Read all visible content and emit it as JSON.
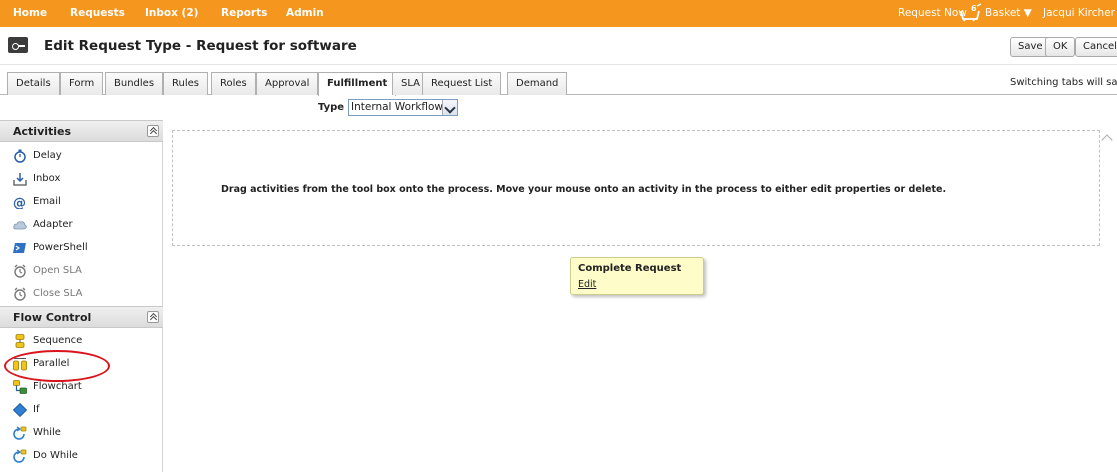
{
  "topnav": {
    "home": "Home",
    "requests": "Requests",
    "inbox": "Inbox (2)",
    "reports": "Reports",
    "admin": "Admin",
    "request_now": "Request Now",
    "basket_count": "6",
    "basket": "Basket ▼",
    "user": "Jacqui Kircher ▼"
  },
  "header": {
    "title": "Edit Request Type - Request for software",
    "save": "Save",
    "ok": "OK",
    "cancel": "Cancel"
  },
  "tabs": [
    {
      "label": "Details"
    },
    {
      "label": "Form"
    },
    {
      "label": "Bundles"
    },
    {
      "label": "Rules"
    },
    {
      "label": "Roles"
    },
    {
      "label": "Approval"
    },
    {
      "label": "Fulfillment",
      "active": true
    },
    {
      "label": "SLA"
    },
    {
      "label": "Request List"
    },
    {
      "label": "Demand"
    }
  ],
  "switch_note": "Switching tabs will save",
  "type": {
    "label": "Type",
    "value": "Internal Workflow"
  },
  "sidebar": {
    "activities": {
      "title": "Activities",
      "items": [
        {
          "label": "Delay",
          "icon": "stopwatch-icon"
        },
        {
          "label": "Inbox",
          "icon": "inbox-tray-icon"
        },
        {
          "label": "Email",
          "icon": "at-sign-icon"
        },
        {
          "label": "Adapter",
          "icon": "cloud-icon"
        },
        {
          "label": "PowerShell",
          "icon": "powershell-icon"
        },
        {
          "label": "Open SLA",
          "icon": "clock-icon"
        },
        {
          "label": "Close SLA",
          "icon": "clock-icon"
        }
      ]
    },
    "flow_control": {
      "title": "Flow Control",
      "items": [
        {
          "label": "Sequence",
          "icon": "sequence-icon"
        },
        {
          "label": "Parallel",
          "icon": "parallel-icon"
        },
        {
          "label": "Flowchart",
          "icon": "flowchart-icon"
        },
        {
          "label": "If",
          "icon": "diamond-icon"
        },
        {
          "label": "While",
          "icon": "loop-icon"
        },
        {
          "label": "Do While",
          "icon": "loop-icon"
        }
      ]
    }
  },
  "canvas": {
    "message": "Drag activities from the tool box onto the process. Move your mouse onto an activity in the process to either edit properties or delete.",
    "complete_title": "Complete Request",
    "complete_edit": "Edit"
  },
  "colors": {
    "nav_orange": "#f5961e",
    "highlight_red": "#d9141c",
    "note_yellow": "#fefcc8"
  }
}
